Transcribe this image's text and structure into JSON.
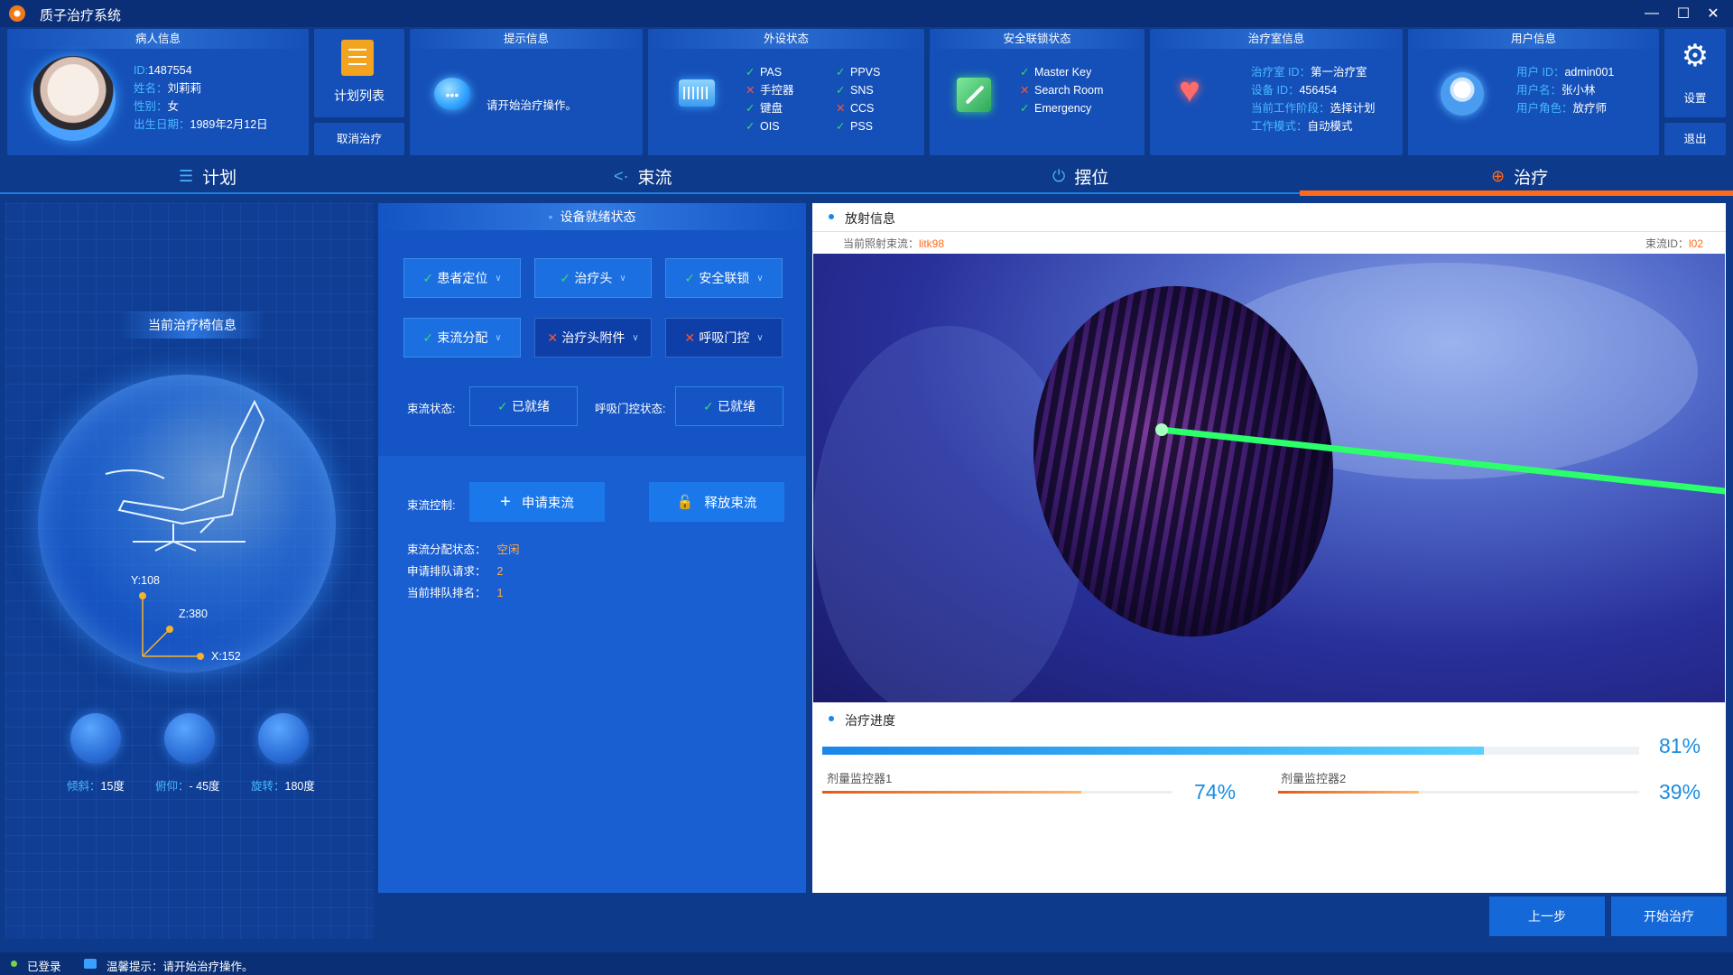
{
  "app": {
    "title": "质子治疗系统"
  },
  "patient": {
    "card_title": "病人信息",
    "id_key": "ID:",
    "id_val": "1487554",
    "name_key": "姓名：",
    "name_val": "刘莉莉",
    "gender_key": "性别：",
    "gender_val": "女",
    "dob_key": "出生日期：",
    "dob_val": "1989年2月12日"
  },
  "plan_card": {
    "label": "计划列表",
    "cancel_label": "取消治疗"
  },
  "prompt": {
    "card_title": "提示信息",
    "message": "请开始治疗操作。"
  },
  "peripherals": {
    "card_title": "外设状态",
    "col1": [
      {
        "name": "PAS",
        "ok": true
      },
      {
        "name": "手控器",
        "ok": false
      },
      {
        "name": "键盘",
        "ok": true
      },
      {
        "name": "OIS",
        "ok": true
      }
    ],
    "col2": [
      {
        "name": "PPVS",
        "ok": true
      },
      {
        "name": "SNS",
        "ok": true
      },
      {
        "name": "CCS",
        "ok": false
      },
      {
        "name": "PSS",
        "ok": true
      }
    ]
  },
  "safety": {
    "card_title": "安全联锁状态",
    "items": [
      {
        "name": "Master Key",
        "ok": true
      },
      {
        "name": "Search Room",
        "ok": false
      },
      {
        "name": "Emergency",
        "ok": true
      }
    ]
  },
  "room": {
    "card_title": "治疗室信息",
    "room_key": "治疗室 ID：",
    "room_val": "第一治疗室",
    "device_key": "设备 ID：",
    "device_val": "456454",
    "stage_key": "当前工作阶段：",
    "stage_val": "选择计划",
    "mode_key": "工作模式：",
    "mode_val": "自动模式"
  },
  "user": {
    "card_title": "用户信息",
    "uid_key": "用户 ID：",
    "uid_val": "admin001",
    "uname_key": "用户名：",
    "uname_val": "张小林",
    "role_key": "用户角色：",
    "role_val": "放疗师"
  },
  "settings": {
    "label": "设置",
    "logout_label": "退出"
  },
  "tabs": [
    {
      "label": "计划",
      "icon": "list-icon"
    },
    {
      "label": "束流",
      "icon": "beam-icon"
    },
    {
      "label": "摆位",
      "icon": "power-icon"
    },
    {
      "label": "治疗",
      "icon": "treatment-icon",
      "active": true
    }
  ],
  "chair": {
    "title": "当前治疗椅信息",
    "y_label": "Y:108",
    "z_label": "Z:380",
    "x_label": "X:152",
    "dials": [
      {
        "key": "倾斜：",
        "val": "15度"
      },
      {
        "key": "俯仰：",
        "val": "- 45度"
      },
      {
        "key": "旋转：",
        "val": "180度"
      }
    ]
  },
  "devices": {
    "title": "设备就绪状态",
    "items": [
      {
        "label": "患者定位",
        "ok": true
      },
      {
        "label": "治疗头",
        "ok": true
      },
      {
        "label": "安全联锁",
        "ok": true
      },
      {
        "label": "束流分配",
        "ok": true
      },
      {
        "label": "治疗头附件",
        "ok": false
      },
      {
        "label": "呼吸门控",
        "ok": false
      }
    ],
    "beam_state_label": "束流状态:",
    "beam_state_val": "已就绪",
    "gating_state_label": "呼吸门控状态:",
    "gating_state_val": "已就绪"
  },
  "beam_control": {
    "label": "束流控制:",
    "request_label": "申请束流",
    "release_label": "释放束流",
    "stats": [
      {
        "key": "束流分配状态：",
        "val": "空闲"
      },
      {
        "key": "申请排队请求：",
        "val": "2"
      },
      {
        "key": "当前排队排名：",
        "val": "1"
      }
    ]
  },
  "radiation": {
    "title": "放射信息",
    "current_beam_key": "当前照射束流：",
    "current_beam_val": "litk98",
    "beam_id_key": "束流ID：",
    "beam_id_val": "l02"
  },
  "progress": {
    "title": "治疗进度",
    "overall_pct": 81,
    "overall_text": "81%",
    "monitors": [
      {
        "label": "剂量监控器1",
        "pct": 74,
        "text": "74%"
      },
      {
        "label": "剂量监控器2",
        "pct": 39,
        "text": "39%"
      }
    ]
  },
  "actions": {
    "prev_label": "上一步",
    "start_label": "开始治疗"
  },
  "status": {
    "login": "已登录",
    "tip": "温馨提示：请开始治疗操作。"
  },
  "colors": {
    "accent": "#1a86e8",
    "active_tab": "#ff6a1a",
    "ok": "#33dd66",
    "error": "#ff5533",
    "laser": "#2bff6a"
  }
}
